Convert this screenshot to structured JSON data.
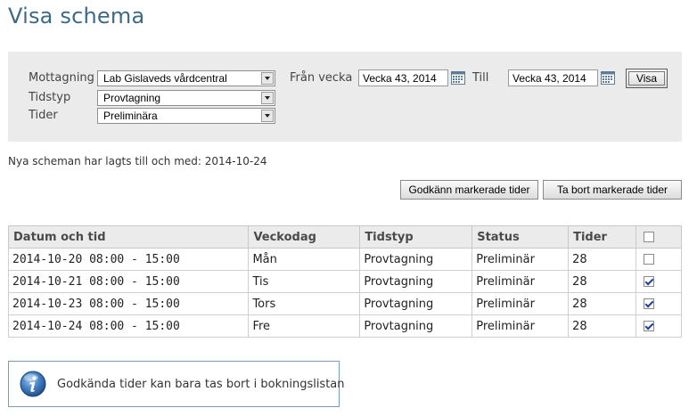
{
  "page": {
    "title": "Visa schema"
  },
  "filters": {
    "mottagning_label": "Mottagning",
    "mottagning_value": "Lab Gislaveds vårdcentral",
    "tidstyp_label": "Tidstyp",
    "tidstyp_value": "Provtagning",
    "tider_label": "Tider",
    "tider_value": "Preliminära",
    "fran_label": "Från vecka",
    "fran_value": "Vecka 43, 2014",
    "till_label": "Till",
    "till_value": "Vecka 43, 2014",
    "visa_label": "Visa"
  },
  "note": "Nya scheman har lagts till och med: 2014-10-24",
  "actions": {
    "approve_label": "Godkänn markerade tider",
    "remove_label": "Ta bort markerade tider"
  },
  "table": {
    "headers": [
      "Datum och tid",
      "Veckodag",
      "Tidstyp",
      "Status",
      "Tider"
    ],
    "rows": [
      {
        "datetime": "2014-10-20 08:00 - 15:00",
        "weekday": "Mån",
        "type": "Provtagning",
        "status": "Preliminär",
        "count": "28",
        "checked": false
      },
      {
        "datetime": "2014-10-21 08:00 - 15:00",
        "weekday": "Tis",
        "type": "Provtagning",
        "status": "Preliminär",
        "count": "28",
        "checked": true
      },
      {
        "datetime": "2014-10-23 08:00 - 15:00",
        "weekday": "Tors",
        "type": "Provtagning",
        "status": "Preliminär",
        "count": "28",
        "checked": true
      },
      {
        "datetime": "2014-10-24 08:00 - 15:00",
        "weekday": "Fre",
        "type": "Provtagning",
        "status": "Preliminär",
        "count": "28",
        "checked": true
      }
    ]
  },
  "info": {
    "text": "Godkända tider kan bara tas bort i bokningslistan",
    "icon": "info-icon"
  },
  "colors": {
    "title": "#3e6a84",
    "panel_bg": "#ebebeb",
    "header_bg": "#ebebeb",
    "info_border": "#7a9bb0"
  }
}
